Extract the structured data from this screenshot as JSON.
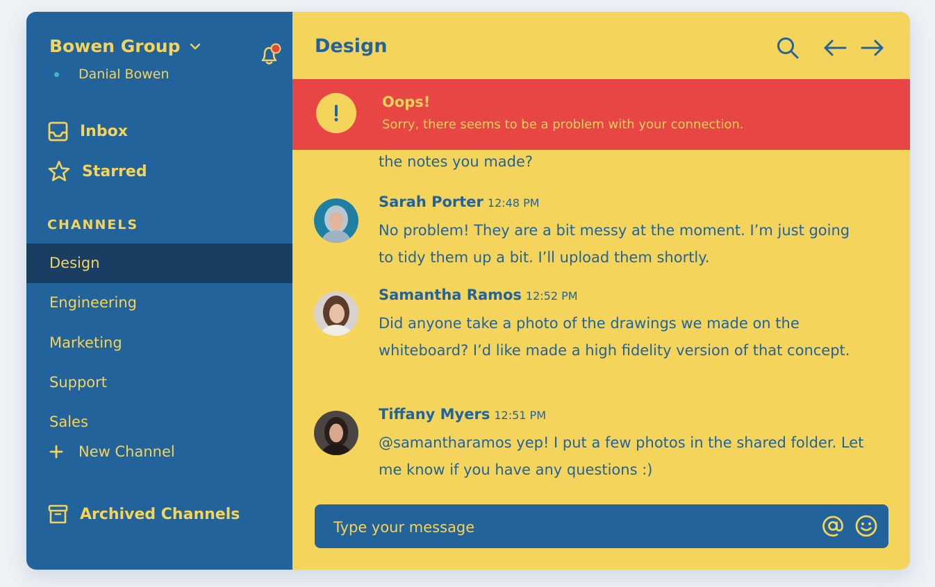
{
  "sidebar": {
    "team_name": "Bowen Group",
    "user_name": "Danial Bowen",
    "inbox_label": "Inbox",
    "starred_label": "Starred",
    "channels_heading": "CHANNELS",
    "channels": [
      {
        "label": "Design",
        "active": true
      },
      {
        "label": "Engineering",
        "active": false
      },
      {
        "label": "Marketing",
        "active": false
      },
      {
        "label": "Support",
        "active": false
      },
      {
        "label": "Sales",
        "active": false
      }
    ],
    "new_channel_label": "New Channel",
    "archived_label": "Archived Channels"
  },
  "header": {
    "title": "Design"
  },
  "alert": {
    "title": "Oops!",
    "text": "Sorry, there seems to be a problem with your connection."
  },
  "messages": {
    "partial_text": "the notes you made?",
    "items": [
      {
        "name": "Sarah Porter",
        "time": "12:48 PM",
        "text": "No problem! They are a bit messy at the moment. I’m just going to tidy them up a bit. I’ll upload them shortly."
      },
      {
        "name": "Samantha Ramos",
        "time": "12:52 PM",
        "text": "Did anyone take a photo of the drawings we made on the whiteboard? I’d like made a high fidelity version of that concept."
      },
      {
        "name": "Tiffany Myers",
        "time": "12:51 PM",
        "text": "@samantharamos yep! I put a few photos in the shared folder. Let me know if you have any questions :)"
      }
    ]
  },
  "composer": {
    "placeholder": "Type your message"
  },
  "colors": {
    "primary_blue": "#21639a",
    "dark_blue": "#1a3e61",
    "yellow": "#f5d45b",
    "alert_red": "#e84545",
    "status_online": "#3fb6c7"
  }
}
